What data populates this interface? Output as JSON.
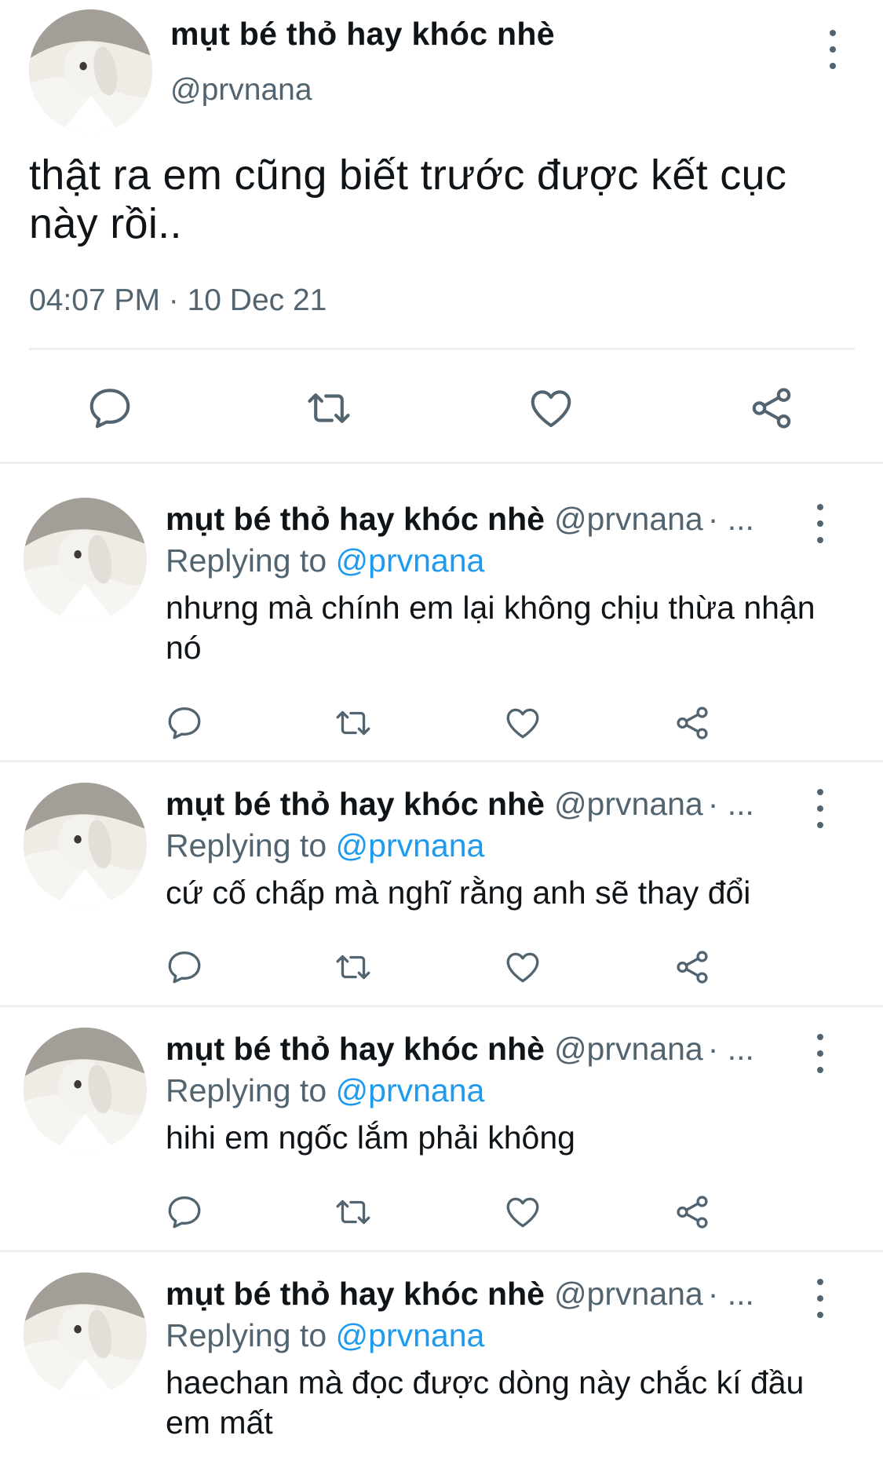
{
  "main_tweet": {
    "name": "mụt bé thỏ hay khóc nhè",
    "handle": "@prvnana",
    "text": "thật ra em cũng biết trước được kết cục này rồi..",
    "timestamp": "04:07 PM · 10 Dec 21",
    "actions": [
      "reply-icon",
      "retweet-icon",
      "like-icon",
      "share-icon"
    ]
  },
  "replies": [
    {
      "name": "mụt bé thỏ hay khóc nhè",
      "handle": "@prvnana",
      "dot": "· ...",
      "replying_label": "Replying to",
      "replying_to": "@prvnana",
      "text": "nhưng mà chính em lại không chịu thừa nhận nó"
    },
    {
      "name": "mụt bé thỏ hay khóc nhè",
      "handle": "@prvnana",
      "dot": "· ...",
      "replying_label": "Replying to",
      "replying_to": "@prvnana",
      "text": "cứ cố chấp mà nghĩ rằng anh sẽ thay đổi"
    },
    {
      "name": "mụt bé thỏ hay khóc nhè",
      "handle": "@prvnana",
      "dot": "· ...",
      "replying_label": "Replying to",
      "replying_to": "@prvnana",
      "text": "hihi em ngốc lắm phải không"
    },
    {
      "name": "mụt bé thỏ hay khóc nhè",
      "handle": "@prvnana",
      "dot": "· ...",
      "replying_label": "Replying to",
      "replying_to": "@prvnana",
      "text": "haechan mà đọc được dòng này chắc kí đầu em mất"
    }
  ],
  "colors": {
    "text": "#0f1419",
    "secondary": "#536471",
    "link": "#1d9bf0",
    "divider": "#eceff1"
  }
}
